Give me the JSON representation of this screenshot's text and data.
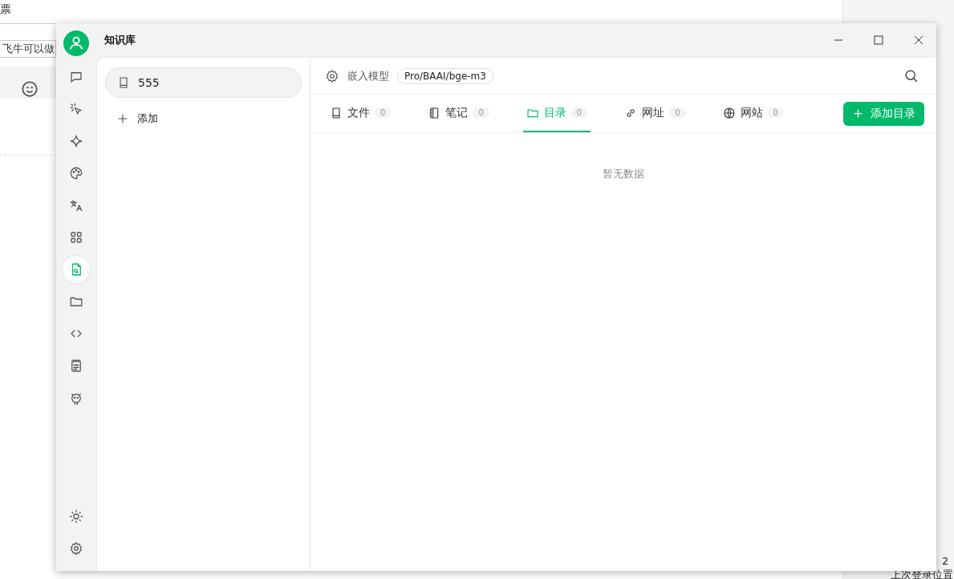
{
  "background": {
    "corner_text": "票",
    "input_value": "飞牛可以做",
    "bottom_texts": [
      "2",
      "上次登录位置"
    ]
  },
  "window": {
    "title": "知识库"
  },
  "nav": [
    {
      "kind": "chat",
      "selected": false
    },
    {
      "kind": "pointer",
      "selected": false
    },
    {
      "kind": "sparkle",
      "selected": false
    },
    {
      "kind": "palette",
      "selected": false
    },
    {
      "kind": "translate",
      "selected": false
    },
    {
      "kind": "apps",
      "selected": false
    },
    {
      "kind": "knowledge",
      "selected": true
    },
    {
      "kind": "folder",
      "selected": false
    },
    {
      "kind": "code",
      "selected": false
    },
    {
      "kind": "notes",
      "selected": false
    },
    {
      "kind": "robot",
      "selected": false
    }
  ],
  "nav_bottom": [
    {
      "kind": "sun"
    },
    {
      "kind": "settings"
    }
  ],
  "bases": [
    {
      "name": "555",
      "selected": true
    }
  ],
  "add_label": "添加",
  "header": {
    "label": "嵌入模型",
    "model": "Pro/BAAI/bge-m3"
  },
  "tabs": [
    {
      "kind": "file",
      "label": "文件",
      "count": "0",
      "selected": false
    },
    {
      "kind": "note",
      "label": "笔记",
      "count": "0",
      "selected": false
    },
    {
      "kind": "folder",
      "label": "目录",
      "count": "0",
      "selected": true
    },
    {
      "kind": "link",
      "label": "网址",
      "count": "0",
      "selected": false
    },
    {
      "kind": "globe",
      "label": "网站",
      "count": "0",
      "selected": false
    }
  ],
  "add_button": "添加目录",
  "empty_text": "暂无数据"
}
